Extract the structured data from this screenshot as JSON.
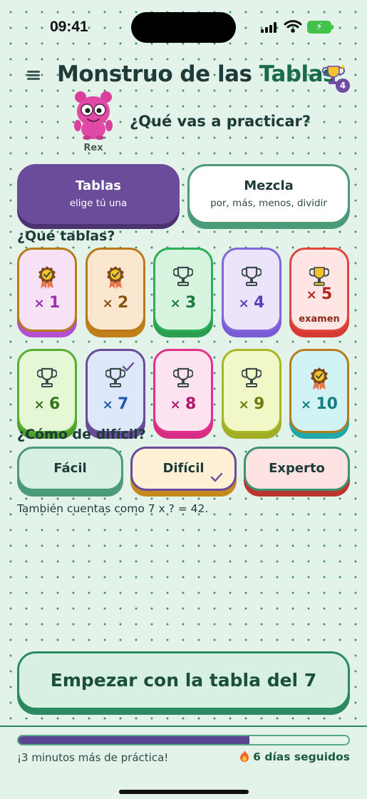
{
  "status_bar": {
    "time": "09:41"
  },
  "header": {
    "title_main": "Monstruo de las",
    "title_accent": "Tablas",
    "trophy_count": "4"
  },
  "mascot": {
    "name": "Rex"
  },
  "question": "¿Qué vas a practicar?",
  "modes": [
    {
      "title": "Tablas",
      "subtitle": "elige tú una",
      "selected": true
    },
    {
      "title": "Mezcla",
      "subtitle": "por, más, menos, dividir",
      "selected": false
    }
  ],
  "tables_label": "¿Qué tablas?",
  "tables": [
    {
      "label": "1",
      "icon": "medal-icon",
      "bg": "#f6e2f4",
      "border": "#b67b1c",
      "shadow": "#b44fcf",
      "text": "#9a2fb0"
    },
    {
      "label": "2",
      "icon": "medal-icon",
      "bg": "#fbe6cf",
      "border": "#b87a1a",
      "shadow": "#c27f1a",
      "text": "#8a5410"
    },
    {
      "label": "3",
      "icon": "trophy-icon",
      "bg": "#d6f4de",
      "border": "#2fae5a",
      "shadow": "#2b9d50",
      "text": "#1d7a3c"
    },
    {
      "label": "4",
      "icon": "trophy-icon",
      "bg": "#ece4fb",
      "border": "#8066d6",
      "shadow": "#7a5bd6",
      "text": "#5a3fc0"
    },
    {
      "label": "5",
      "icon": "gold-trophy-icon",
      "sub": "examen",
      "bg": "#ffe5e3",
      "border": "#e0463c",
      "shadow": "#d63a33",
      "text": "#b42520"
    },
    {
      "label": "6",
      "icon": "trophy-icon",
      "bg": "#e6f7d6",
      "border": "#55b02e",
      "shadow": "#4f9f2b",
      "text": "#33761a"
    },
    {
      "label": "7",
      "icon": "trophy-icon",
      "selected": true,
      "bg": "#dde8fb",
      "border": "#6b4c9a",
      "shadow": "#6b4c9a",
      "text": "#1f5bb0"
    },
    {
      "label": "8",
      "icon": "trophy-icon",
      "bg": "#fde2f0",
      "border": "#e2308c",
      "shadow": "#d72d84",
      "text": "#b3166a"
    },
    {
      "label": "9",
      "icon": "trophy-icon",
      "bg": "#f1f7c6",
      "border": "#a8b626",
      "shadow": "#a1ad24",
      "text": "#6d7a10"
    },
    {
      "label": "10",
      "icon": "medal-icon",
      "bg": "#d2f3f3",
      "border": "#b67b1c",
      "shadow": "#1fa9ab",
      "text": "#137d80"
    }
  ],
  "difficulty_label": "¿Cómo de difícil?",
  "difficulties": [
    {
      "label": "Fácil",
      "bg": "#d8f0e3",
      "border": "#4b9a78",
      "shadow": "#4b9a78",
      "selected": false
    },
    {
      "label": "Difícil",
      "bg": "#fdf0d5",
      "border": "#6b4c9a",
      "shadow": "#c48a1e",
      "selected": true
    },
    {
      "label": "Experto",
      "bg": "#fde4e2",
      "border": "#3c9470",
      "shadow": "#b8362d",
      "selected": false
    }
  ],
  "hint": "También cuentas como 7 x ? = 42.",
  "start_label": "Empezar con la tabla del 7",
  "progress": {
    "fraction": 0.7,
    "text": "¡3 minutos más de práctica!"
  },
  "streak": "6 días seguidos"
}
